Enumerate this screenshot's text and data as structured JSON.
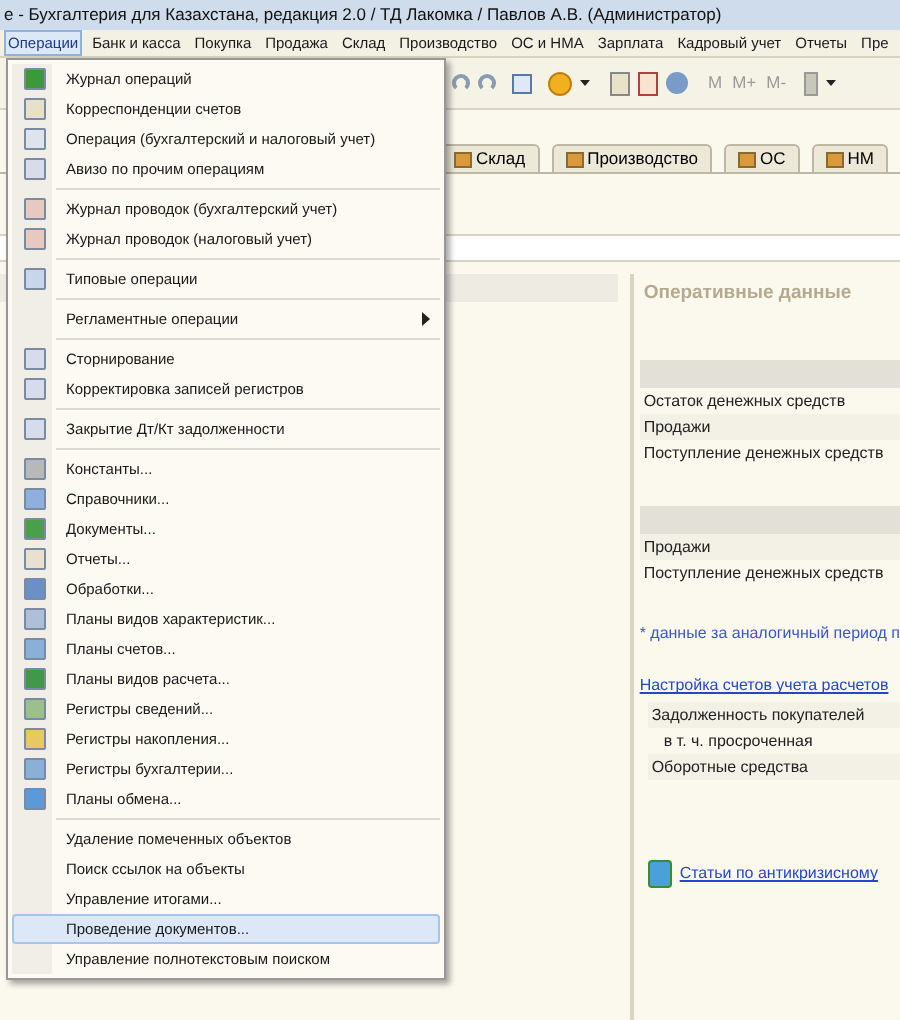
{
  "window": {
    "title": "е - Бухгалтерия для Казахстана, редакция 2.0 / ТД Лакомка / Павлов А.В. (Администратор)"
  },
  "menu_bar": [
    {
      "label": "Операции",
      "selected": true
    },
    {
      "label": "Банк и касса",
      "selected": false
    },
    {
      "label": "Покупка",
      "selected": false
    },
    {
      "label": "Продажа",
      "selected": false
    },
    {
      "label": "Склад",
      "selected": false
    },
    {
      "label": "Производство",
      "selected": false
    },
    {
      "label": "ОС и НМА",
      "selected": false
    },
    {
      "label": "Зарплата",
      "selected": false
    },
    {
      "label": "Кадровый учет",
      "selected": false
    },
    {
      "label": "Отчеты",
      "selected": false
    },
    {
      "label": "Пре",
      "selected": false
    }
  ],
  "toolbar": {
    "memory_buttons": [
      "M",
      "M+",
      "M-"
    ]
  },
  "tabs": [
    {
      "label": "Склад",
      "selected": false
    },
    {
      "label": "Производство",
      "selected": false
    },
    {
      "label": "ОС",
      "selected": false
    },
    {
      "label": "НМ",
      "selected": false
    }
  ],
  "dropdown_menu": [
    {
      "kind": "item",
      "label": "Журнал операций",
      "selected": false
    },
    {
      "kind": "item",
      "label": "Корреспонденции счетов",
      "selected": false
    },
    {
      "kind": "item",
      "label": "Операция (бухгалтерский и налоговый учет)",
      "selected": false
    },
    {
      "kind": "item",
      "label": "Авизо по прочим операциям",
      "selected": false
    },
    {
      "kind": "separator"
    },
    {
      "kind": "item",
      "label": "Журнал проводок (бухгалтерский учет)",
      "selected": false
    },
    {
      "kind": "item",
      "label": "Журнал проводок (налоговый учет)",
      "selected": false
    },
    {
      "kind": "separator"
    },
    {
      "kind": "item",
      "label": "Типовые операции",
      "selected": false
    },
    {
      "kind": "separator"
    },
    {
      "kind": "submenu",
      "label": "Регламентные операции",
      "selected": false
    },
    {
      "kind": "separator"
    },
    {
      "kind": "item",
      "label": "Сторнирование",
      "selected": false
    },
    {
      "kind": "item",
      "label": "Корректировка записей регистров",
      "selected": false
    },
    {
      "kind": "separator"
    },
    {
      "kind": "item",
      "label": "Закрытие Дт/Кт задолженности",
      "selected": false
    },
    {
      "kind": "separator"
    },
    {
      "kind": "item",
      "label": "Константы...",
      "selected": false
    },
    {
      "kind": "item",
      "label": "Справочники...",
      "selected": false
    },
    {
      "kind": "item",
      "label": "Документы...",
      "selected": false
    },
    {
      "kind": "item",
      "label": "Отчеты...",
      "selected": false
    },
    {
      "kind": "item",
      "label": "Обработки...",
      "selected": false
    },
    {
      "kind": "item",
      "label": "Планы видов характеристик...",
      "selected": false
    },
    {
      "kind": "item",
      "label": "Планы счетов...",
      "selected": false
    },
    {
      "kind": "item",
      "label": "Планы видов расчета...",
      "selected": false
    },
    {
      "kind": "item",
      "label": "Регистры сведений...",
      "selected": false
    },
    {
      "kind": "item",
      "label": "Регистры накопления...",
      "selected": false
    },
    {
      "kind": "item",
      "label": "Регистры бухгалтерии...",
      "selected": false
    },
    {
      "kind": "item",
      "label": "Планы обмена...",
      "selected": false
    },
    {
      "kind": "separator"
    },
    {
      "kind": "item",
      "label": "Удаление помеченных объектов",
      "selected": false
    },
    {
      "kind": "item",
      "label": "Поиск ссылок на объекты",
      "selected": false
    },
    {
      "kind": "item",
      "label": "Управление итогами...",
      "selected": false
    },
    {
      "kind": "item",
      "label": "Проведение документов...",
      "selected": true
    },
    {
      "kind": "item",
      "label": "Управление полнотекстовым поиском",
      "selected": false
    }
  ],
  "operational_panel": {
    "title": "Оперативные данные",
    "sections": [
      {
        "rows": [
          "Остаток денежных средств",
          "Продажи",
          "Поступление денежных средств"
        ]
      },
      {
        "rows": [
          "Продажи",
          "Поступление денежных средств"
        ]
      }
    ],
    "footnote": "* данные за аналогичный период п",
    "settings_link": "Настройка счетов учета расчетов",
    "debt_rows": [
      {
        "label": "Задолженность покупателей",
        "indented": false
      },
      {
        "label": "в т. ч. просроченная",
        "indented": true
      },
      {
        "label": "Оборотные средства",
        "indented": false
      }
    ],
    "articles_link": "Статьи по антикризисному"
  }
}
